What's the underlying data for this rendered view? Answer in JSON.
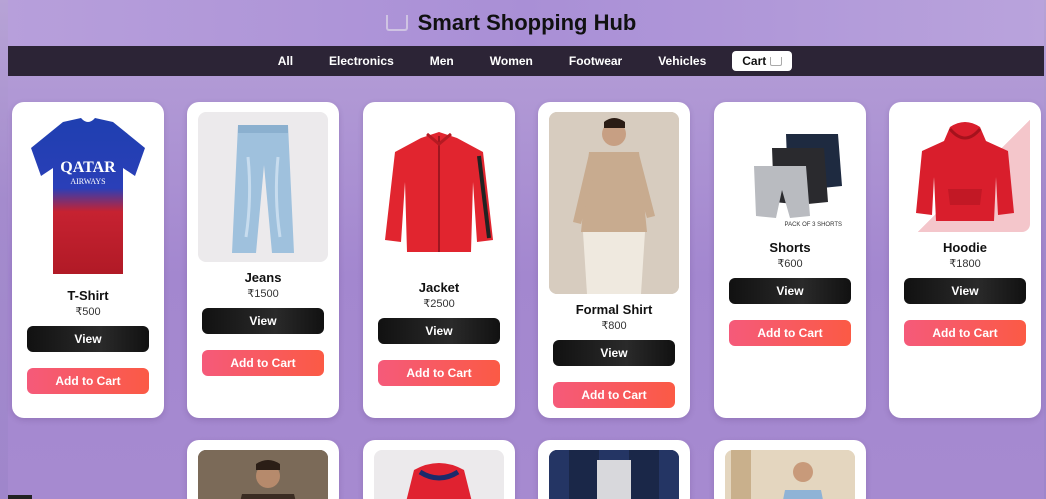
{
  "header": {
    "title": "Smart Shopping Hub",
    "cart_icon": "shopping-cart-icon"
  },
  "nav": {
    "items": [
      "All",
      "Electronics",
      "Men",
      "Women",
      "Footwear",
      "Vehicles"
    ],
    "cart_label": "Cart"
  },
  "products": [
    {
      "name": "T-Shirt",
      "price": "₹500",
      "view": "View",
      "add": "Add to Cart"
    },
    {
      "name": "Jeans",
      "price": "₹1500",
      "view": "View",
      "add": "Add to Cart"
    },
    {
      "name": "Jacket",
      "price": "₹2500",
      "view": "View",
      "add": "Add to Cart"
    },
    {
      "name": "Formal Shirt",
      "price": "₹800",
      "view": "View",
      "add": "Add to Cart"
    },
    {
      "name": "Shorts",
      "price": "₹600",
      "view": "View",
      "add": "Add to Cart",
      "image_caption": "PACK OF 3 SHORTS"
    },
    {
      "name": "Hoodie",
      "price": "₹1800",
      "view": "View",
      "add": "Add to Cart"
    }
  ],
  "tshirt_print": {
    "brand": "QATAR",
    "sub": "AIRWAYS"
  },
  "colors": {
    "accent_red": "#e63946",
    "button_dark": "#111111",
    "add_gradient_start": "#f55a7a",
    "add_gradient_end": "#fb5a45",
    "nav_bg": "#2c2436"
  }
}
